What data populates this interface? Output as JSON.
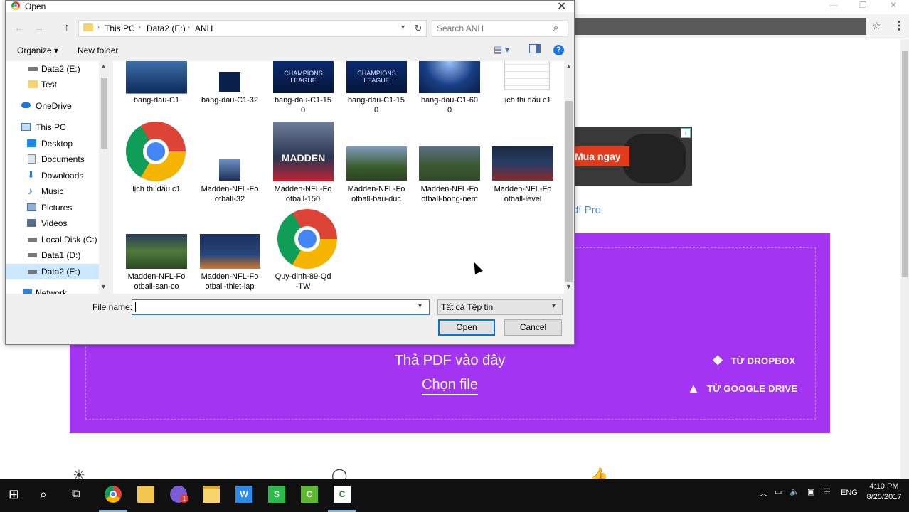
{
  "browser": {
    "ad_button": "Mua ngay",
    "ad_info": "i",
    "pdf_pro": "df Pro",
    "drop_title": "Thả PDF vào đây",
    "choose_file": "Chọn file",
    "dropbox": "TỪ DROPBOX",
    "google_drive": "TỪ GOOGLE DRIVE",
    "accent_color": "#a335f2"
  },
  "dialog": {
    "title": "Open",
    "breadcrumbs": [
      "This PC",
      "Data2 (E:)",
      "ANH"
    ],
    "search_placeholder": "Search ANH",
    "organize": "Organize ▾",
    "new_folder": "New folder",
    "nav_items": [
      {
        "label": "Data2 (E:)",
        "icon": "drive-icon"
      },
      {
        "label": "Test",
        "icon": "folder-icon"
      },
      {
        "label": "OneDrive",
        "icon": "cloud-icon"
      },
      {
        "label": "This PC",
        "icon": "computer-icon"
      },
      {
        "label": "Desktop",
        "icon": "desktop-icon"
      },
      {
        "label": "Documents",
        "icon": "documents-icon"
      },
      {
        "label": "Downloads",
        "icon": "downloads-icon"
      },
      {
        "label": "Music",
        "icon": "music-icon"
      },
      {
        "label": "Pictures",
        "icon": "pictures-icon"
      },
      {
        "label": "Videos",
        "icon": "videos-icon"
      },
      {
        "label": "Local Disk (C:)",
        "icon": "drive-icon"
      },
      {
        "label": "Data1 (D:)",
        "icon": "drive-icon"
      },
      {
        "label": "Data2 (E:)",
        "icon": "drive-icon"
      },
      {
        "label": "Network",
        "icon": "network-icon"
      }
    ],
    "files": [
      {
        "label": "bang-dau-C1",
        "type": "image"
      },
      {
        "label": "bang-dau-C1-32",
        "type": "image"
      },
      {
        "label": "bang-dau-C1-150",
        "type": "image"
      },
      {
        "label": "bang-dau-C1-150",
        "type": "image"
      },
      {
        "label": "bang-dau-C1-600",
        "type": "image"
      },
      {
        "label": "lịch thi đấu c1",
        "type": "document"
      },
      {
        "label": "lịch thi đấu c1",
        "type": "chrome-html"
      },
      {
        "label": "Madden-NFL-Football-32",
        "type": "image"
      },
      {
        "label": "Madden-NFL-Football-150",
        "type": "image"
      },
      {
        "label": "Madden-NFL-Football-bau-duc",
        "type": "image"
      },
      {
        "label": "Madden-NFL-Football-bong-nem",
        "type": "image"
      },
      {
        "label": "Madden-NFL-Football-level",
        "type": "image"
      },
      {
        "label": "Madden-NFL-Football-san-co",
        "type": "image"
      },
      {
        "label": "Madden-NFL-Football-thiet-lap",
        "type": "image"
      },
      {
        "label": "Quy-dinh-89-Qd-TW",
        "type": "chrome-html"
      }
    ],
    "file_labels_wrapped": [
      [
        "bang-dau-C1"
      ],
      [
        "bang-dau-C1-32"
      ],
      [
        "bang-dau-C1-15",
        "0"
      ],
      [
        "bang-dau-C1-15",
        "0"
      ],
      [
        "bang-dau-C1-60",
        "0"
      ],
      [
        "lịch thi đấu c1"
      ],
      [
        "lịch thi đấu c1"
      ],
      [
        "Madden-NFL-Fo",
        "otball-32"
      ],
      [
        "Madden-NFL-Fo",
        "otball-150"
      ],
      [
        "Madden-NFL-Fo",
        "otball-bau-duc"
      ],
      [
        "Madden-NFL-Fo",
        "otball-bong-nem"
      ],
      [
        "Madden-NFL-Fo",
        "otball-level"
      ],
      [
        "Madden-NFL-Fo",
        "otball-san-co"
      ],
      [
        "Madden-NFL-Fo",
        "otball-thiet-lap"
      ],
      [
        "Quy-dinh-89-Qd",
        "-TW"
      ]
    ],
    "champions_text": "CHAMPIONS",
    "league_text": "LEAGUE",
    "madden_text": "MADDEN",
    "filename_label": "File name:",
    "filename_value": "",
    "filetype_value": "Tất cả Tệp tin",
    "open_button": "Open",
    "cancel_button": "Cancel"
  },
  "taskbar": {
    "language": "ENG",
    "time": "4:10 PM",
    "date": "8/25/2017",
    "badge": "1"
  }
}
